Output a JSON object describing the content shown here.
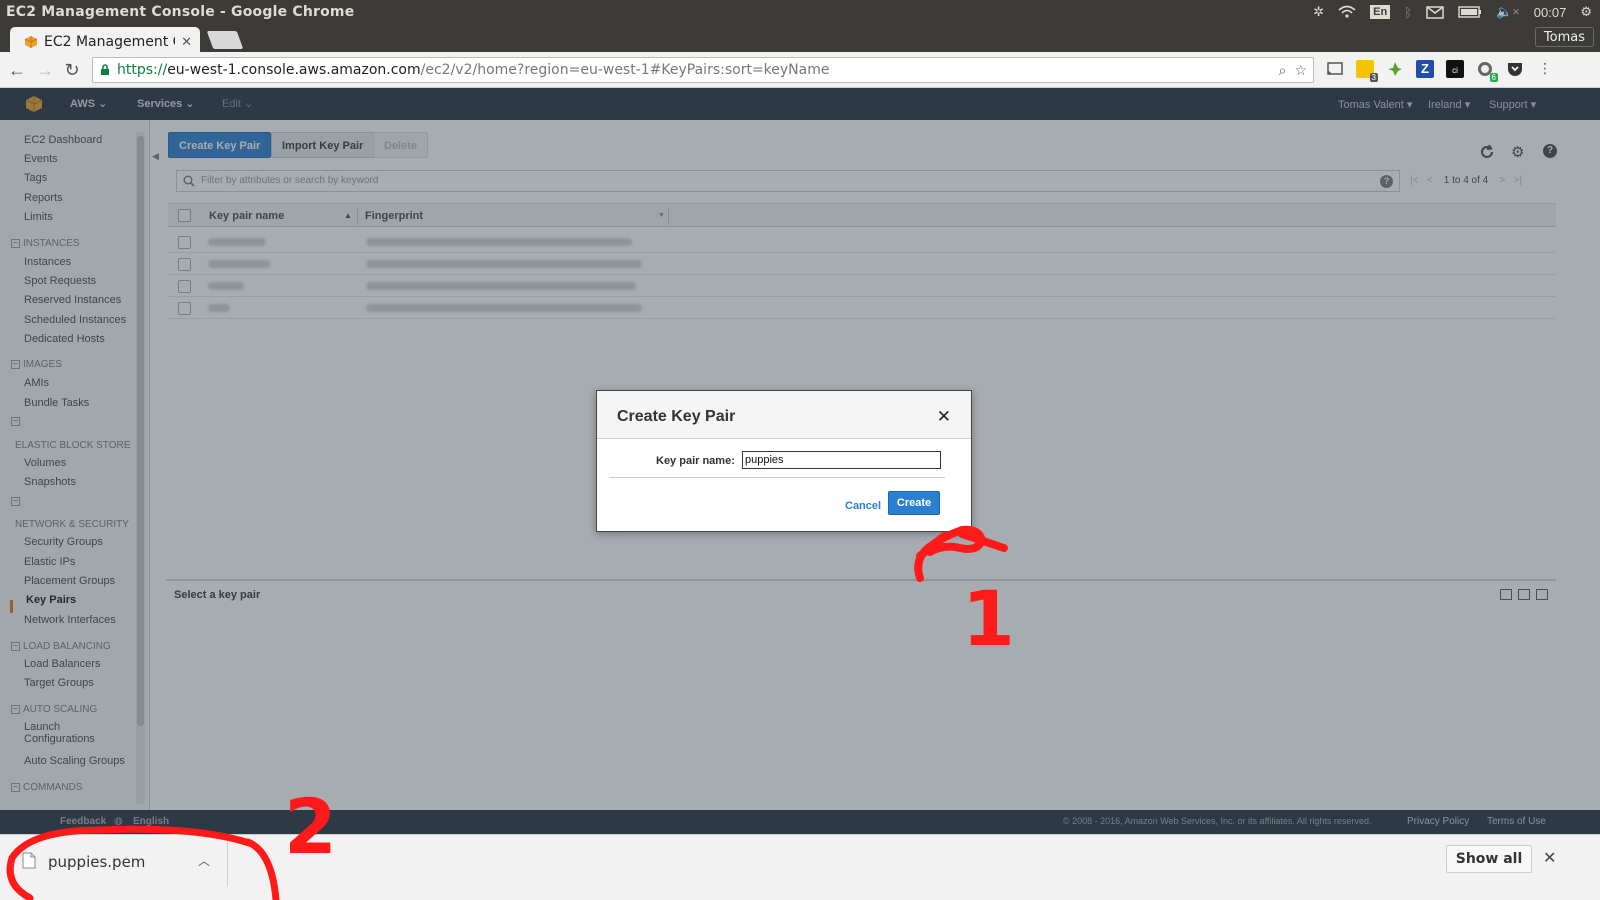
{
  "os": {
    "window_title": "EC2 Management Console - Google Chrome",
    "keyboard_layout": "En",
    "clock": "00:07"
  },
  "browser": {
    "tab_title": "EC2 Management C",
    "user": "Tomas",
    "url_scheme": "https://",
    "url_host": "eu-west-1.console.aws.amazon.com",
    "url_path": "/ec2/v2/home?region=eu-west-1#KeyPairs:sort=keyName",
    "extension_badges": [
      "3",
      "6"
    ]
  },
  "aws_nav": {
    "aws": "AWS",
    "services": "Services",
    "edit": "Edit",
    "account": "Tomas Valent",
    "region": "Ireland",
    "support": "Support"
  },
  "sidebar": {
    "top_links": [
      "EC2 Dashboard",
      "Events",
      "Tags",
      "Reports",
      "Limits"
    ],
    "instances_head": "INSTANCES",
    "instances": [
      "Instances",
      "Spot Requests",
      "Reserved Instances",
      "Scheduled Instances",
      "Dedicated Hosts"
    ],
    "images_head": "IMAGES",
    "images": [
      "AMIs",
      "Bundle Tasks"
    ],
    "ebs_head": "ELASTIC BLOCK STORE",
    "ebs": [
      "Volumes",
      "Snapshots"
    ],
    "network_head": "NETWORK & SECURITY",
    "network": [
      "Security Groups",
      "Elastic IPs",
      "Placement Groups",
      "Key Pairs",
      "Network Interfaces"
    ],
    "lb_head": "LOAD BALANCING",
    "lb": [
      "Load Balancers",
      "Target Groups"
    ],
    "as_head": "AUTO SCALING",
    "as_launch_1": "Launch",
    "as_launch_2": "Configurations",
    "as_groups": "Auto Scaling Groups",
    "commands_head": "COMMANDS"
  },
  "main": {
    "create_button": "Create Key Pair",
    "import_button": "Import Key Pair",
    "delete_button": "Delete",
    "search_placeholder": "Filter by attributes or search by keyword",
    "pager": "1 to 4 of 4",
    "col_name": "Key pair name",
    "col_fingerprint": "Fingerprint",
    "row_count": 4,
    "detail_label": "Select a key pair"
  },
  "footer": {
    "feedback": "Feedback",
    "language": "English",
    "copyright": "© 2008 - 2016, Amazon Web Services, Inc. or its affiliates. All rights reserved.",
    "privacy": "Privacy Policy",
    "terms": "Terms of Use"
  },
  "modal": {
    "title": "Create Key Pair",
    "field_label": "Key pair name:",
    "field_value": "puppies",
    "cancel": "Cancel",
    "create": "Create"
  },
  "downloads": {
    "file_name": "puppies.pem",
    "show_all": "Show all"
  },
  "annotations": {
    "step_1": "1",
    "step_2": "2",
    "color": "#ff1a1a"
  },
  "colors": {
    "aws_nav": "#232f3e",
    "primary": "#2a7fd1",
    "active_marker": "#e47911"
  }
}
